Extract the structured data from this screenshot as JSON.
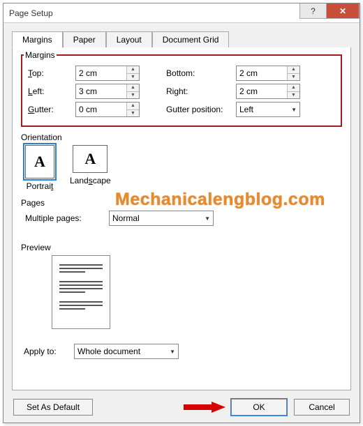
{
  "window": {
    "title": "Page Setup",
    "help": "?",
    "close": "✕"
  },
  "tabs": [
    {
      "label": "Margins",
      "active": true
    },
    {
      "label": "Paper",
      "active": false
    },
    {
      "label": "Layout",
      "active": false
    },
    {
      "label": "Document Grid",
      "active": false
    }
  ],
  "margins_section": {
    "label": "Margins",
    "top": {
      "label": "Top:",
      "value": "2 cm"
    },
    "bottom": {
      "label": "Bottom:",
      "value": "2 cm"
    },
    "left": {
      "label": "Left:",
      "value": "3 cm"
    },
    "right": {
      "label": "Right:",
      "value": "2 cm"
    },
    "gutter": {
      "label": "Gutter:",
      "value": "0 cm"
    },
    "gutterpos": {
      "label": "Gutter position:",
      "value": "Left"
    }
  },
  "orientation": {
    "label": "Orientation",
    "portrait": "Portrait",
    "landscape": "Landscape"
  },
  "pages": {
    "label": "Pages",
    "multiple_label": "Multiple pages:",
    "multiple_value": "Normal"
  },
  "preview": {
    "label": "Preview"
  },
  "apply": {
    "label": "Apply to:",
    "value": "Whole document"
  },
  "buttons": {
    "default": "Set As Default",
    "ok": "OK",
    "cancel": "Cancel"
  },
  "watermark": "Mechanicalengblog.com"
}
